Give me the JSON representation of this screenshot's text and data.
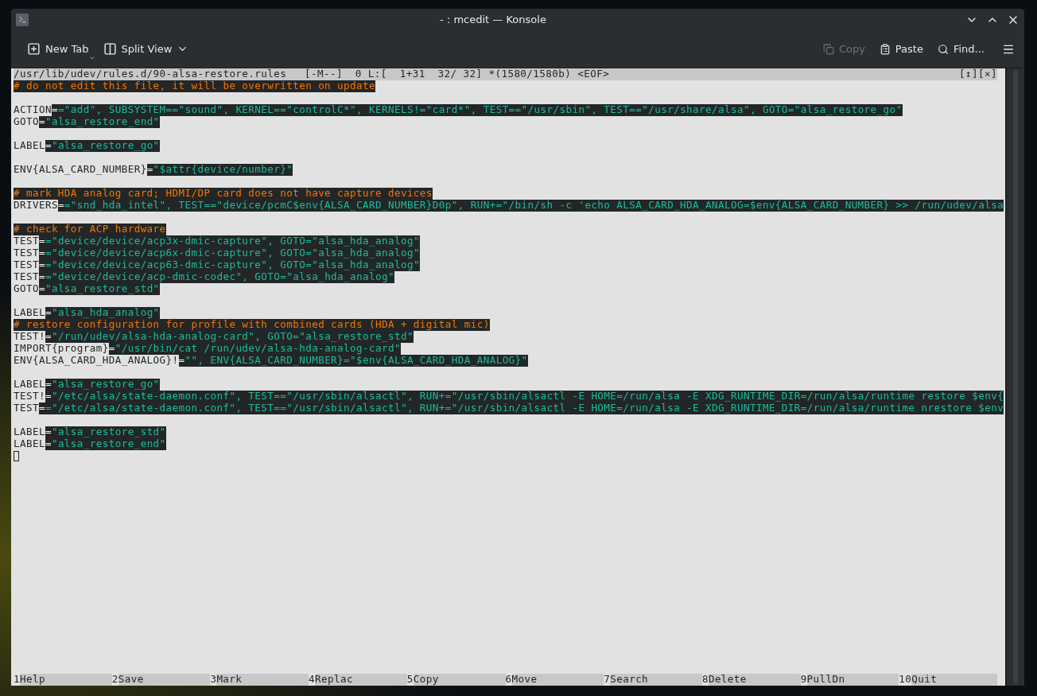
{
  "window": {
    "title": "- : mcedit — Konsole"
  },
  "toolbar": {
    "left": [
      {
        "kind": "newtab",
        "label": "New Tab",
        "disabled": false
      },
      {
        "kind": "split",
        "label": "Split View",
        "disabled": false
      }
    ],
    "right": [
      {
        "kind": "copy",
        "label": "Copy",
        "disabled": true
      },
      {
        "kind": "paste",
        "label": "Paste",
        "disabled": false
      },
      {
        "kind": "find",
        "label": "Find...",
        "disabled": false
      }
    ]
  },
  "editor": {
    "status": {
      "file": "/usr/lib/udev/rules.d/90-alsa-restore.rules",
      "info": "[-M--]  0 L:[  1+31  32/ 32] *(1580/1580b) <EOF>",
      "controls": "[↕][×]"
    },
    "lines": [
      {
        "kind": "code",
        "segments": [
          {
            "kind": "comment",
            "text": "# do not edit this file, it will be overwritten on update"
          }
        ]
      },
      {
        "kind": "blank"
      },
      {
        "kind": "code",
        "segments": [
          {
            "kind": "key",
            "text": "ACTION"
          },
          {
            "kind": "op",
            "text": "="
          },
          {
            "kind": "value",
            "text": "=\"add\", SUBSYSTEM==\"sound\", KERNEL==\"controlC*\", KERNELS!=\"card*\", TEST==\"/usr/sbin\", TEST==\"/usr/share/alsa\", GOTO=\"alsa_restore_go\""
          }
        ]
      },
      {
        "kind": "code",
        "segments": [
          {
            "kind": "key",
            "text": "GOTO"
          },
          {
            "kind": "op",
            "text": "="
          },
          {
            "kind": "value",
            "text": "\"alsa_restore_end\""
          }
        ]
      },
      {
        "kind": "blank"
      },
      {
        "kind": "code",
        "segments": [
          {
            "kind": "key",
            "text": "LABEL"
          },
          {
            "kind": "op",
            "text": "="
          },
          {
            "kind": "value",
            "text": "\"alsa_restore_go\""
          }
        ]
      },
      {
        "kind": "blank"
      },
      {
        "kind": "code",
        "segments": [
          {
            "kind": "key",
            "text": "ENV{ALSA_CARD_NUMBER}"
          },
          {
            "kind": "op",
            "text": "="
          },
          {
            "kind": "value",
            "text": "\"$attr{device/number}\""
          }
        ]
      },
      {
        "kind": "blank"
      },
      {
        "kind": "code",
        "segments": [
          {
            "kind": "comment",
            "text": "# mark HDA analog card; HDMI/DP card does not have capture devices"
          }
        ]
      },
      {
        "kind": "code",
        "segments": [
          {
            "kind": "key",
            "text": "DRIVERS"
          },
          {
            "kind": "op",
            "text": "="
          },
          {
            "kind": "value",
            "text": "=\"snd_hda_intel\", TEST==\"device/pcmC$env{ALSA_CARD_NUMBER}D0p\", RUN+=\"/bin/sh -c 'echo ALSA_CARD_HDA_ANALOG=$env{ALSA_CARD_NUMBER} >> /run/udev/alsa"
          }
        ]
      },
      {
        "kind": "blank"
      },
      {
        "kind": "code",
        "segments": [
          {
            "kind": "comment",
            "text": "# check for ACP hardware"
          }
        ]
      },
      {
        "kind": "code",
        "segments": [
          {
            "kind": "key",
            "text": "TEST"
          },
          {
            "kind": "op",
            "text": "="
          },
          {
            "kind": "value",
            "text": "=\"device/device/acp3x-dmic-capture\", GOTO=\"alsa_hda_analog\""
          }
        ]
      },
      {
        "kind": "code",
        "segments": [
          {
            "kind": "key",
            "text": "TEST"
          },
          {
            "kind": "op",
            "text": "="
          },
          {
            "kind": "value",
            "text": "=\"device/device/acp6x-dmic-capture\", GOTO=\"alsa_hda_analog\""
          }
        ]
      },
      {
        "kind": "code",
        "segments": [
          {
            "kind": "key",
            "text": "TEST"
          },
          {
            "kind": "op",
            "text": "="
          },
          {
            "kind": "value",
            "text": "=\"device/device/acp63-dmic-capture\", GOTO=\"alsa_hda_analog\""
          }
        ]
      },
      {
        "kind": "code",
        "segments": [
          {
            "kind": "key",
            "text": "TEST"
          },
          {
            "kind": "op",
            "text": "="
          },
          {
            "kind": "value",
            "text": "=\"device/device/acp-dmic-codec\", GOTO=\"alsa_hda_analog\""
          }
        ]
      },
      {
        "kind": "code",
        "segments": [
          {
            "kind": "key",
            "text": "GOTO"
          },
          {
            "kind": "op",
            "text": "="
          },
          {
            "kind": "value",
            "text": "\"alsa_restore_std\""
          }
        ]
      },
      {
        "kind": "blank"
      },
      {
        "kind": "code",
        "segments": [
          {
            "kind": "key",
            "text": "LABEL"
          },
          {
            "kind": "op",
            "text": "="
          },
          {
            "kind": "value",
            "text": "\"alsa_hda_analog\""
          }
        ]
      },
      {
        "kind": "code",
        "segments": [
          {
            "kind": "comment",
            "text": "# restore configuration for profile with combined cards (HDA + digital mic)"
          }
        ]
      },
      {
        "kind": "code",
        "segments": [
          {
            "kind": "key",
            "text": "TEST!"
          },
          {
            "kind": "op",
            "text": "="
          },
          {
            "kind": "value",
            "text": "\"/run/udev/alsa-hda-analog-card\", GOTO=\"alsa_restore_std\""
          }
        ]
      },
      {
        "kind": "code",
        "segments": [
          {
            "kind": "key",
            "text": "IMPORT{program}"
          },
          {
            "kind": "op",
            "text": "="
          },
          {
            "kind": "value",
            "text": "\"/usr/bin/cat /run/udev/alsa-hda-analog-card\""
          }
        ]
      },
      {
        "kind": "code",
        "segments": [
          {
            "kind": "key",
            "text": "ENV{ALSA_CARD_HDA_ANALOG}!"
          },
          {
            "kind": "op",
            "text": "="
          },
          {
            "kind": "value",
            "text": "\"\", ENV{ALSA_CARD_NUMBER}=\"$env{ALSA_CARD_HDA_ANALOG}\""
          }
        ]
      },
      {
        "kind": "blank"
      },
      {
        "kind": "code",
        "segments": [
          {
            "kind": "key",
            "text": "LABEL"
          },
          {
            "kind": "op",
            "text": "="
          },
          {
            "kind": "value",
            "text": "\"alsa_restore_go\""
          }
        ]
      },
      {
        "kind": "code",
        "segments": [
          {
            "kind": "key",
            "text": "TEST!"
          },
          {
            "kind": "op",
            "text": "="
          },
          {
            "kind": "value",
            "text": "\"/etc/alsa/state-daemon.conf\", TEST==\"/usr/sbin/alsactl\", RUN+=\"/usr/sbin/alsactl -E HOME=/run/alsa -E XDG_RUNTIME_DIR=/run/alsa/runtime restore $env{"
          }
        ]
      },
      {
        "kind": "code",
        "segments": [
          {
            "kind": "key",
            "text": "TEST"
          },
          {
            "kind": "op",
            "text": "="
          },
          {
            "kind": "value",
            "text": "=\"/etc/alsa/state-daemon.conf\", TEST==\"/usr/sbin/alsactl\", RUN+=\"/usr/sbin/alsactl -E HOME=/run/alsa -E XDG_RUNTIME_DIR=/run/alsa/runtime nrestore $env"
          }
        ]
      },
      {
        "kind": "blank"
      },
      {
        "kind": "code",
        "segments": [
          {
            "kind": "key",
            "text": "LABEL"
          },
          {
            "kind": "op",
            "text": "="
          },
          {
            "kind": "value",
            "text": "\"alsa_restore_std\""
          }
        ]
      },
      {
        "kind": "code",
        "segments": [
          {
            "kind": "key",
            "text": "LABEL"
          },
          {
            "kind": "op",
            "text": "="
          },
          {
            "kind": "value",
            "text": "\"alsa_restore_end\""
          }
        ]
      },
      {
        "kind": "cursor"
      }
    ],
    "function_keys": [
      {
        "number": "1",
        "label": "Help"
      },
      {
        "number": "2",
        "label": "Save"
      },
      {
        "number": "3",
        "label": "Mark"
      },
      {
        "number": "4",
        "label": "Replac"
      },
      {
        "number": "5",
        "label": "Copy"
      },
      {
        "number": "6",
        "label": "Move"
      },
      {
        "number": "7",
        "label": "Search"
      },
      {
        "number": "8",
        "label": "Delete"
      },
      {
        "number": "9",
        "label": "PullDn"
      },
      {
        "number": "10",
        "label": "Quit"
      }
    ]
  }
}
